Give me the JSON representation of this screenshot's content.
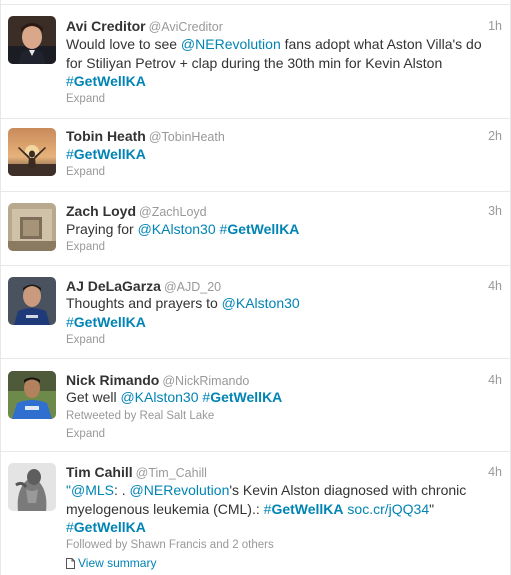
{
  "tweets": [
    {
      "fullname": "Avi Creditor",
      "username": "@AviCreditor",
      "time": "1h",
      "text": {
        "t1": "Would love to see ",
        "m1": "@NERevolution",
        "t2": " fans adopt what Aston Villa's do",
        "line2": "for Stiliyan Petrov + clap during the 30th min for Kevin Alston",
        "h1_hash": "#",
        "h1_tag": "GetWellKA"
      },
      "expand": "Expand"
    },
    {
      "fullname": "Tobin Heath",
      "username": "@TobinHeath",
      "time": "2h",
      "text": {
        "h1_hash": "#",
        "h1_tag": "GetWellKA"
      },
      "expand": "Expand"
    },
    {
      "fullname": "Zach Loyd",
      "username": "@ZachLoyd",
      "time": "3h",
      "text": {
        "t1": "Praying for ",
        "m1": "@KAlston30",
        "h1_hash": "#",
        "h1_tag": "GetWellKA"
      },
      "expand": "Expand"
    },
    {
      "fullname": "AJ DeLaGarza",
      "username": "@AJD_20",
      "time": "4h",
      "text": {
        "t1": "Thoughts and prayers to ",
        "m1": "@KAlston30",
        "h1_hash": "#",
        "h1_tag": "GetWellKA"
      },
      "expand": "Expand"
    },
    {
      "fullname": "Nick Rimando",
      "username": "@NickRimando",
      "time": "4h",
      "text": {
        "t1": "Get well ",
        "m1": "@KAlston30",
        "h1_hash": "#",
        "h1_tag": "GetWellKA"
      },
      "retweeted_by": "Retweeted by Real Salt Lake",
      "expand": "Expand"
    },
    {
      "fullname": "Tim Cahill",
      "username": "@Tim_Cahill",
      "time": "4h",
      "text": {
        "q1": "\"",
        "m1": "@MLS",
        "t1": ": . ",
        "m2": "@NERevolution",
        "t2": "'s Kevin Alston diagnosed with chronic",
        "line2a": "myelogenous leukemia (CML).: ",
        "h1_hash": "#",
        "h1_tag": "GetWellKA",
        "link": "soc.cr/jQQ34",
        "q2": "\"",
        "h2_hash": "#",
        "h2_tag": "GetWellKA"
      },
      "followed_by": "Followed by Shawn Francis and 2 others",
      "summary": "View summary"
    }
  ]
}
